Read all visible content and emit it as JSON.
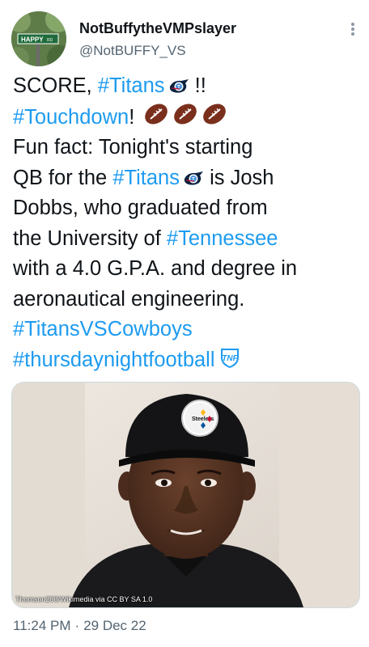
{
  "user": {
    "display_name": "NotBuffytheVMPslayer",
    "handle": "@NotBUFFY_VS",
    "avatar_sign_text": "HAPPY",
    "avatar_sign_suffix": "RD"
  },
  "tweet": {
    "line1_a": "SCORE, ",
    "tag_titans": "#Titans",
    "line1_b": " !!",
    "tag_touchdown": "#Touchdown",
    "line2_b": "! ",
    "body_a": "Fun fact: Tonight's starting\nQB for the ",
    "body_b": " is Josh\nDobbs, who graduated from\nthe University of ",
    "tag_tennessee": "#Tennessee",
    "body_c": "\nwith a 4.0 G.P.A. and degree in\naeronautical engineering.\n",
    "tag_titansvscowboys": "#TitansVSCowboys",
    "tag_tnf": "#thursdaynightfootball"
  },
  "media": {
    "credit": "Thomson200/Wikimedia via CC BY SA 1.0"
  },
  "meta": {
    "time": "11:24 PM",
    "separator": "·",
    "date": "29 Dec 22"
  },
  "icons": {
    "more": "more-dots-icon",
    "titans": "titans-logo-icon",
    "football": "football-emoji-icon",
    "tnf": "tnf-logo-icon"
  },
  "colors": {
    "link": "#1d9bf0",
    "text": "#0f1419",
    "secondary": "#536471"
  }
}
